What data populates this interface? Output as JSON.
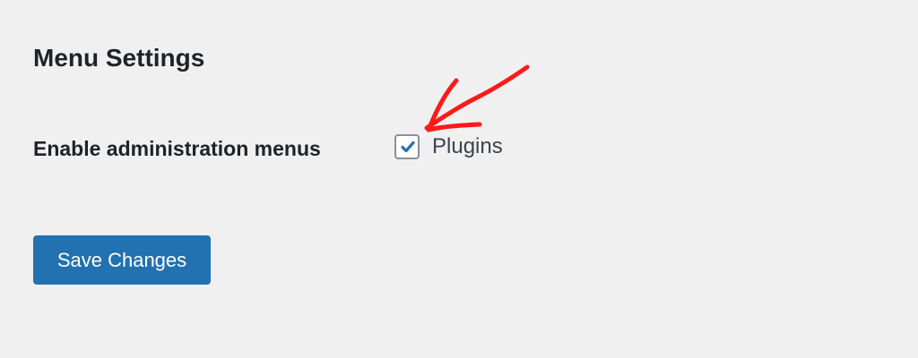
{
  "page": {
    "section_title": "Menu Settings"
  },
  "setting": {
    "label": "Enable administration menus",
    "option": {
      "label": "Plugins",
      "checked": true
    }
  },
  "actions": {
    "save_label": "Save Changes"
  },
  "colors": {
    "background": "#f0f0f1",
    "text": "#1d2327",
    "button_blue": "#2271b1",
    "checkbox_check": "#2271b1",
    "annotation_red": "#ff1a1a"
  },
  "icons": {
    "checkmark": "checkmark-icon",
    "annotation_arrow": "arrow-annotation-icon"
  }
}
